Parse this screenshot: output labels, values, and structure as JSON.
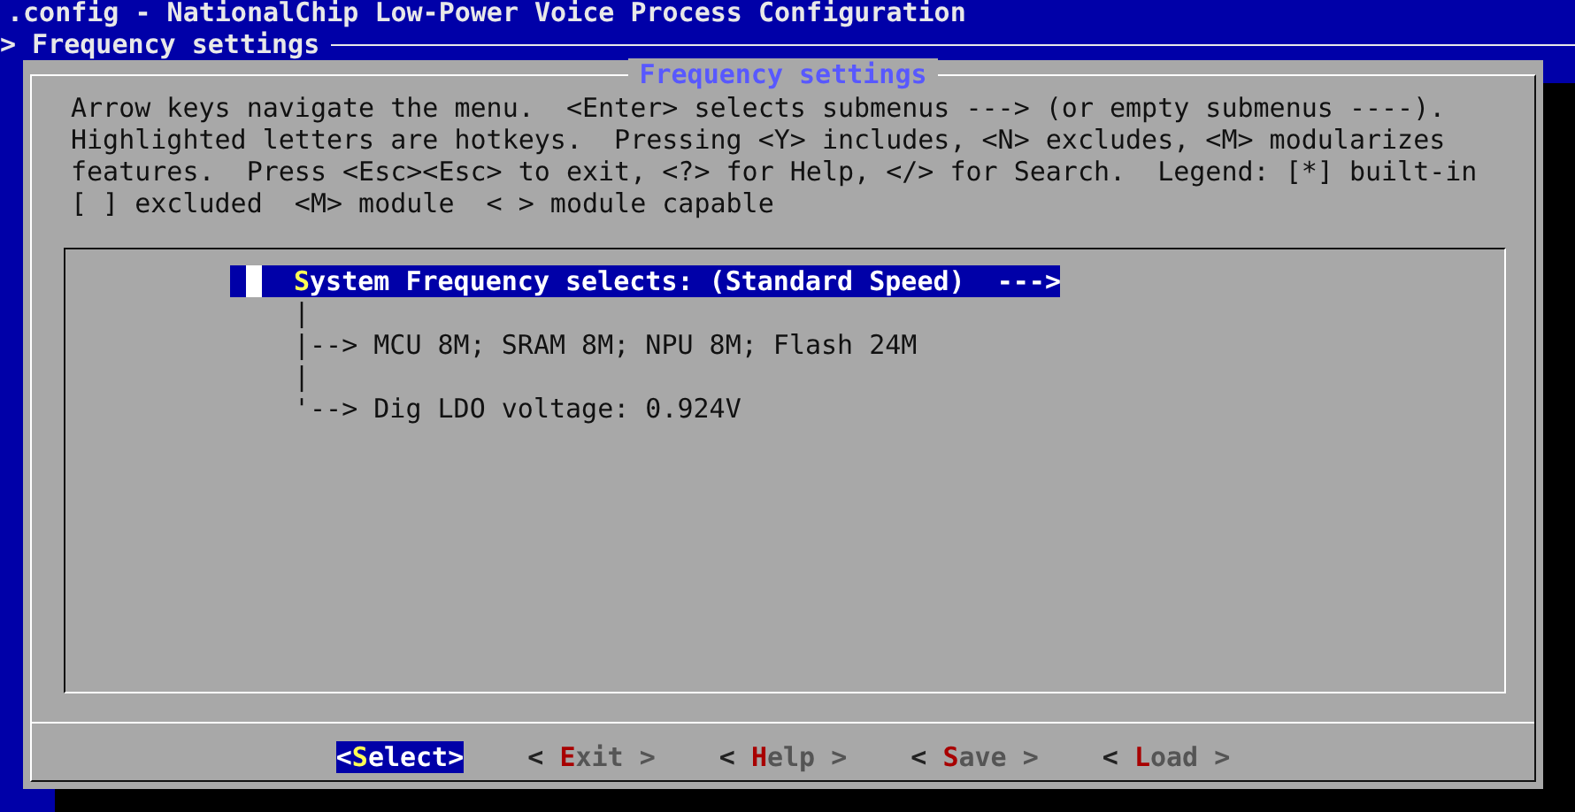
{
  "window": {
    "title": ".config - NationalChip Low-Power Voice Process Configuration"
  },
  "breadcrumb": "> Frequency settings",
  "dialog": {
    "title": "Frequency settings",
    "help": "Arrow keys navigate the menu.  <Enter> selects submenus ---> (or empty submenus ----).\nHighlighted letters are hotkeys.  Pressing <Y> includes, <N> excludes, <M> modularizes\nfeatures.  Press <Esc><Esc> to exit, <?> for Help, </> for Search.  Legend: [*] built-in\n[ ] excluded  <M> module  < > module capable"
  },
  "menu": [
    {
      "kind": "menu",
      "text": "System Frequency selects: (Standard Speed)  --->",
      "selected": true
    },
    {
      "kind": "comment",
      "text": "|",
      "selected": false
    },
    {
      "kind": "comment",
      "text": "|--> MCU 8M; SRAM 8M; NPU 8M; Flash 24M",
      "selected": false
    },
    {
      "kind": "comment",
      "text": "|",
      "selected": false
    },
    {
      "kind": "comment",
      "text": "'--> Dig LDO voltage: 0.924V",
      "selected": false
    }
  ],
  "buttons": [
    {
      "label": "<Select>",
      "selected": true
    },
    {
      "label": "< Exit >",
      "selected": false
    },
    {
      "label": "< Help >",
      "selected": false
    },
    {
      "label": "< Save >",
      "selected": false
    },
    {
      "label": "< Load >",
      "selected": false
    }
  ]
}
